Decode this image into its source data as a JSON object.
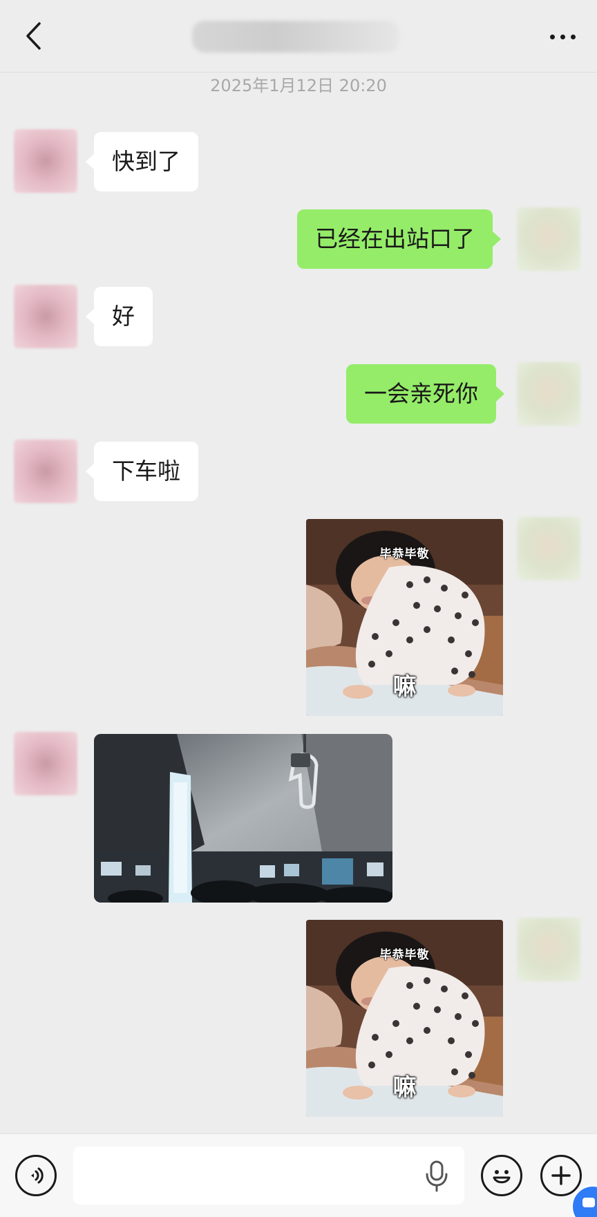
{
  "header": {
    "back_icon": "chevron-left-icon",
    "title": "",
    "more_icon": "more-dots-icon"
  },
  "chat": {
    "timestamp": "2025年1月12日 20:20",
    "messages": [
      {
        "sender": "peer",
        "type": "text",
        "text": "快到了"
      },
      {
        "sender": "me",
        "type": "text",
        "text": "已经在出站口了"
      },
      {
        "sender": "peer",
        "type": "text",
        "text": "好"
      },
      {
        "sender": "me",
        "type": "text",
        "text": "一会亲死你"
      },
      {
        "sender": "peer",
        "type": "text",
        "text": "下车啦"
      },
      {
        "sender": "me",
        "type": "sticker",
        "caption": "毕恭毕敬",
        "word": "嘛"
      },
      {
        "sender": "peer",
        "type": "photo"
      },
      {
        "sender": "me",
        "type": "sticker",
        "caption": "毕恭毕敬",
        "word": "嘛"
      }
    ]
  },
  "input_bar": {
    "voice_icon": "voice-icon",
    "placeholder": "",
    "mic_icon": "microphone-icon",
    "emoji_icon": "emoji-icon",
    "plus_icon": "plus-icon"
  },
  "colors": {
    "background": "#ededed",
    "my_bubble": "#95ec69",
    "peer_bubble": "#ffffff",
    "timestamp_text": "#a8a8a8",
    "float_button": "#2f7cf6"
  }
}
